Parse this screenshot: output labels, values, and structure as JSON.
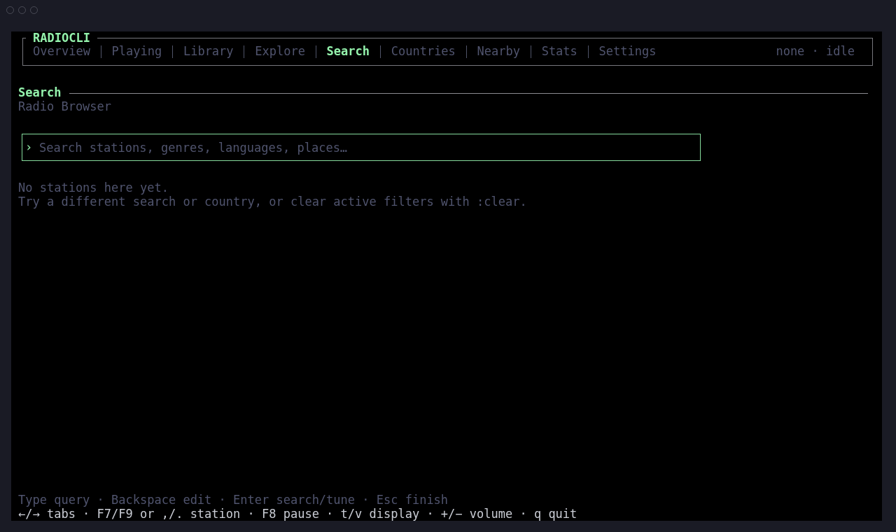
{
  "app": {
    "title": "RADIOCLI"
  },
  "tabs": [
    {
      "label": "Overview",
      "selected": false
    },
    {
      "label": "Playing",
      "selected": false
    },
    {
      "label": "Library",
      "selected": false
    },
    {
      "label": "Explore",
      "selected": false
    },
    {
      "label": "Search",
      "selected": true
    },
    {
      "label": "Countries",
      "selected": false
    },
    {
      "label": "Nearby",
      "selected": false
    },
    {
      "label": "Stats",
      "selected": false
    },
    {
      "label": "Settings",
      "selected": false
    }
  ],
  "status": "none · idle",
  "section": {
    "title": "Search",
    "subtitle": "Radio Browser"
  },
  "search": {
    "prompt": "›",
    "placeholder": "Search stations, genres, languages, places…"
  },
  "empty_state": {
    "message": "No stations here yet.",
    "hint": "Try a different search or country, or clear active filters with :clear."
  },
  "footer": {
    "context_hints": "Type query · Backspace edit · Enter search/tune · Esc finish",
    "key_hints": "←/→ tabs · F7/F9 or ,/. station · F8 pause · t/v display · +/− volume · q quit"
  }
}
